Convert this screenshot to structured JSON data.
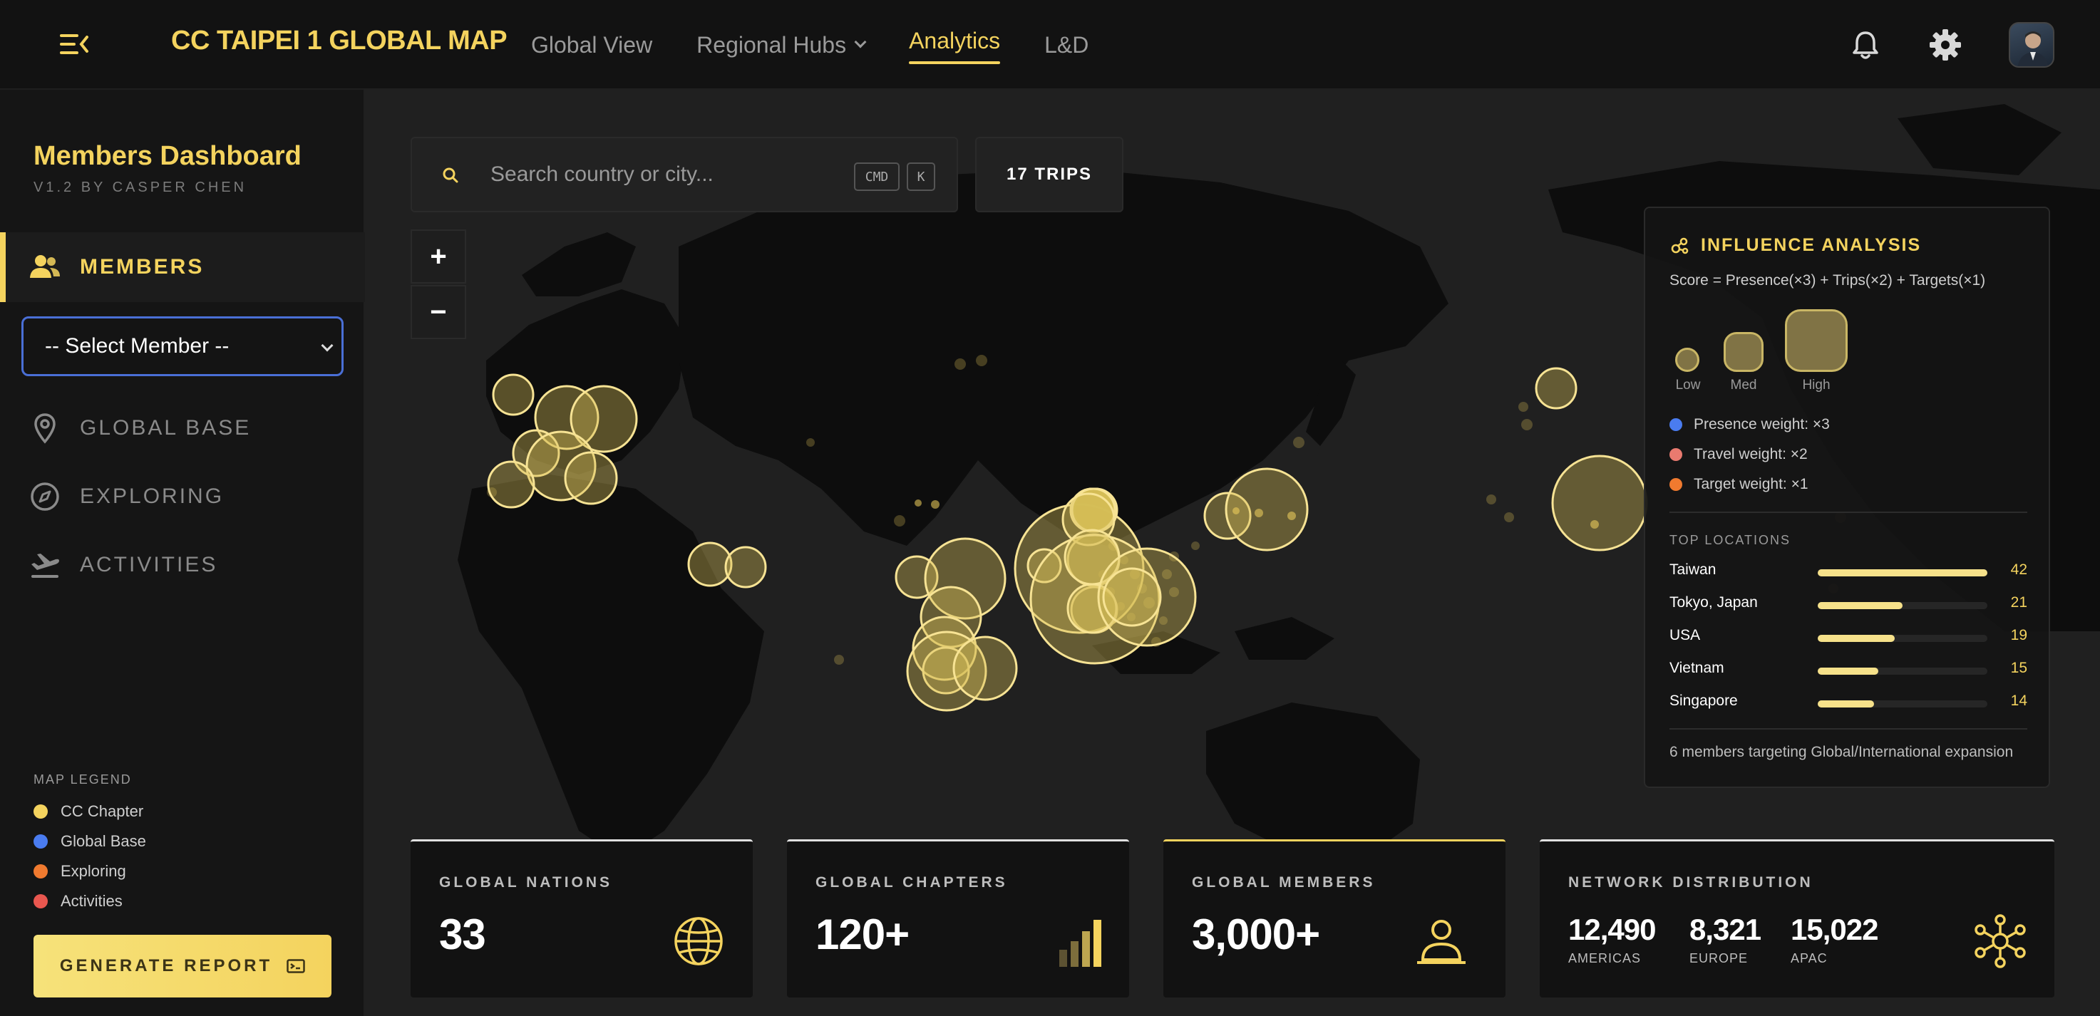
{
  "header": {
    "brand": "CC TAIPEI 1 GLOBAL MAP",
    "nav": [
      {
        "label": "Global View"
      },
      {
        "label": "Regional Hubs"
      },
      {
        "label": "Analytics"
      },
      {
        "label": "L&D"
      }
    ],
    "active_nav": "Analytics",
    "icons": [
      "menu-collapse-icon",
      "bell-icon",
      "gear-icon",
      "avatar"
    ]
  },
  "sidebar": {
    "title": "Members Dashboard",
    "subtitle": "V1.2 BY CASPER CHEN",
    "active_item": "MEMBERS",
    "select_value": "-- Select Member --",
    "items": [
      {
        "label": "GLOBAL BASE",
        "icon": "map-pin-icon"
      },
      {
        "label": "EXPLORING",
        "icon": "compass-icon"
      },
      {
        "label": "ACTIVITIES",
        "icon": "plane-icon"
      }
    ],
    "legend_title": "MAP LEGEND",
    "legend": [
      {
        "label": "CC Chapter",
        "color": "#f4d35e"
      },
      {
        "label": "Global Base",
        "color": "#4a7cf0"
      },
      {
        "label": "Exploring",
        "color": "#f07a2f"
      },
      {
        "label": "Activities",
        "color": "#e9574f"
      }
    ],
    "report_button": "GENERATE REPORT"
  },
  "map": {
    "search_placeholder": "Search country or city...",
    "kbd_cmd": "CMD",
    "kbd_k": "K",
    "trips_label": "17 TRIPS",
    "zoom_in": "+",
    "zoom_out": "−"
  },
  "panel": {
    "title": "INFLUENCE ANALYSIS",
    "formula": "Score = Presence(×3) + Trips(×2) + Targets(×1)",
    "scale": [
      "Low",
      "Med",
      "High"
    ],
    "weights": [
      {
        "label": "Presence weight: ×3",
        "color": "#4a7cf0"
      },
      {
        "label": "Travel weight: ×2",
        "color": "#e97a6f"
      },
      {
        "label": "Target weight: ×1",
        "color": "#f07a2f"
      }
    ],
    "top_title": "TOP LOCATIONS",
    "top_locations": [
      {
        "name": "Taiwan",
        "value": 42
      },
      {
        "name": "Tokyo, Japan",
        "value": 21
      },
      {
        "name": "USA",
        "value": 19
      },
      {
        "name": "Vietnam",
        "value": 15
      },
      {
        "name": "Singapore",
        "value": 14
      }
    ],
    "footer": "6 members targeting Global/International expansion"
  },
  "stats": {
    "nations": {
      "label": "GLOBAL NATIONS",
      "value": "33"
    },
    "chapters": {
      "label": "GLOBAL CHAPTERS",
      "value": "120+"
    },
    "members": {
      "label": "GLOBAL MEMBERS",
      "value": "3,000+"
    },
    "network": {
      "label": "NETWORK DISTRIBUTION",
      "regions": [
        {
          "value": "12,490",
          "region": "AMERICAS"
        },
        {
          "value": "8,321",
          "region": "EUROPE"
        },
        {
          "value": "15,022",
          "region": "APAC"
        }
      ]
    }
  }
}
